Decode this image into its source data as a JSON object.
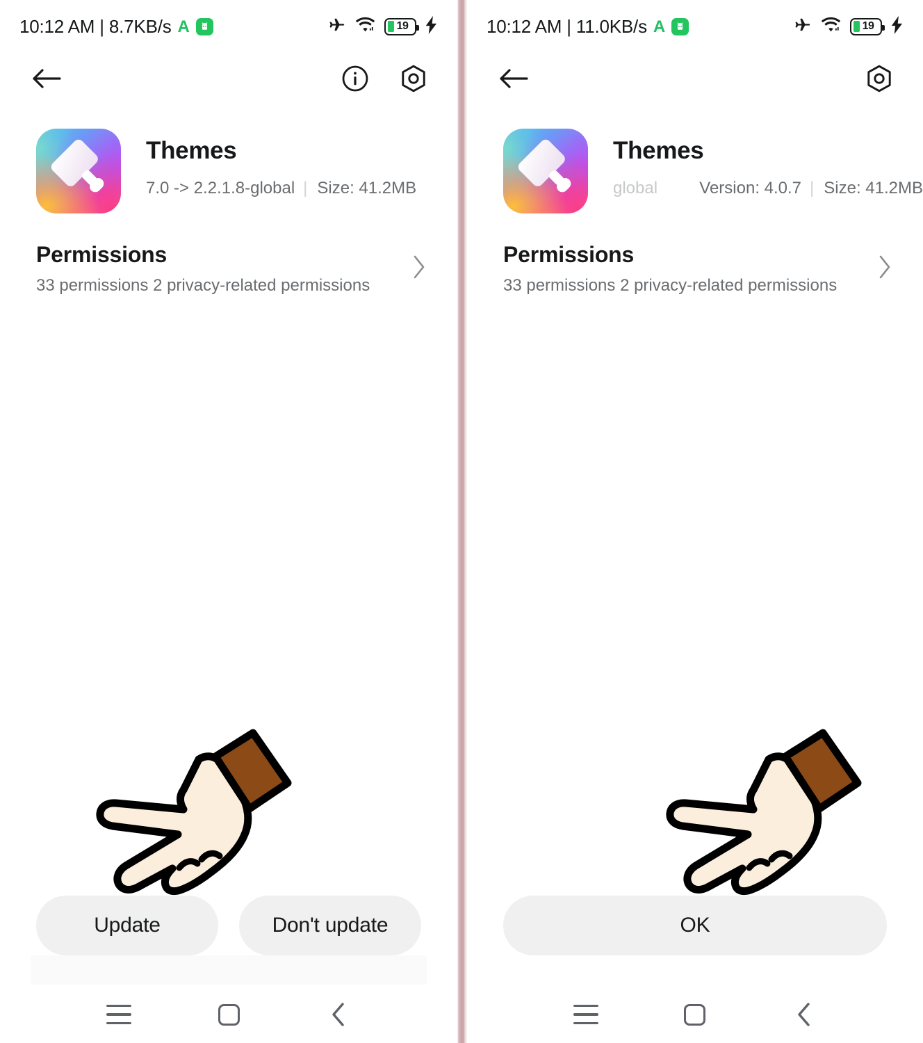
{
  "colors": {
    "background": "#ffffff",
    "divider": "#c9a5a9",
    "text_primary": "#16181a",
    "text_secondary": "#6a6d70",
    "button_bg": "#f0f0f0",
    "battery_green": "#22c55e",
    "accent_green": "#21c063",
    "hand_skin": "#fbeedd",
    "hand_sleeve": "#8c4a17",
    "hand_outline": "#000000"
  },
  "panels": {
    "left": {
      "status_bar": {
        "time": "10:12 AM",
        "separator": "|",
        "network_speed": "8.7KB/s",
        "alipay_icon": "alipay-a-icon",
        "android_icon": "android-robot-icon",
        "airplane_icon": "airplane-mode-icon",
        "wifi_icon": "wifi-icon",
        "battery_level": "19",
        "battery_icon": "battery-icon",
        "charging_icon": "charging-bolt-icon"
      },
      "app_bar": {
        "back_icon": "back-arrow-icon",
        "info_icon": "info-circle-icon",
        "settings_icon": "settings-hexagon-icon",
        "show_info": true
      },
      "app": {
        "icon": "themes-app-icon",
        "name": "Themes",
        "version_text": "7.0 -> 2.2.1.8-global",
        "version_prefix_faded": "7",
        "separator": "|",
        "size_text": "Size: 41.2MB"
      },
      "permissions": {
        "title": "Permissions",
        "subtitle": "33 permissions 2 privacy-related permissions",
        "chevron_icon": "chevron-right-icon"
      },
      "cursor": {
        "icon": "pointing-hand-cursor"
      },
      "buttons": [
        {
          "label": "Update",
          "name": "update-button"
        },
        {
          "label": "Don't update",
          "name": "dont-update-button"
        }
      ],
      "nav_bar": {
        "recents_icon": "recents-menu-icon",
        "home_icon": "home-square-icon",
        "back_icon": "nav-back-chevron-icon"
      }
    },
    "right": {
      "status_bar": {
        "time": "10:12 AM",
        "separator": "|",
        "network_speed": "11.0KB/s",
        "alipay_icon": "alipay-a-icon",
        "android_icon": "android-robot-icon",
        "airplane_icon": "airplane-mode-icon",
        "wifi_icon": "wifi-icon",
        "battery_level": "19",
        "battery_icon": "battery-icon",
        "charging_icon": "charging-bolt-icon"
      },
      "app_bar": {
        "back_icon": "back-arrow-icon",
        "settings_icon": "settings-hexagon-icon",
        "show_info": false
      },
      "app": {
        "icon": "themes-app-icon",
        "name": "Themes",
        "version_fading_out": "global",
        "version_text": "Version: 4.0.7",
        "version_suffix_faded": "7",
        "separator": "|",
        "size_text": "Size: 41.2MB"
      },
      "permissions": {
        "title": "Permissions",
        "subtitle": "33 permissions 2 privacy-related permissions",
        "chevron_icon": "chevron-right-icon"
      },
      "cursor": {
        "icon": "pointing-hand-cursor"
      },
      "buttons": [
        {
          "label": "OK",
          "name": "ok-button"
        }
      ],
      "nav_bar": {
        "recents_icon": "recents-menu-icon",
        "home_icon": "home-square-icon",
        "back_icon": "nav-back-chevron-icon"
      }
    }
  }
}
